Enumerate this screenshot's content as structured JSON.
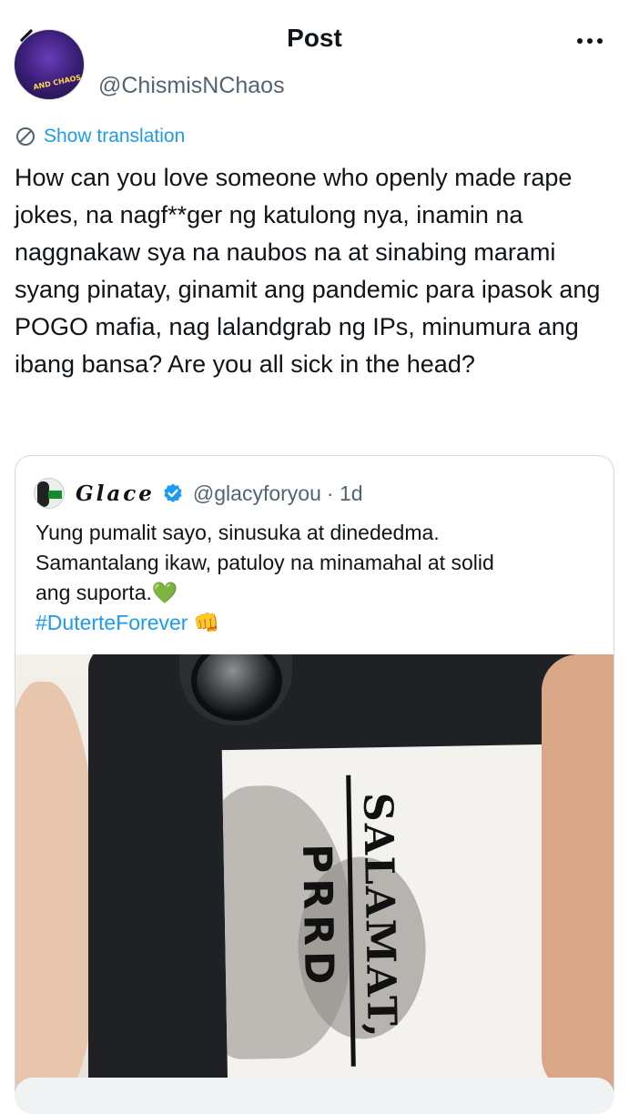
{
  "topbar": {
    "title": "Post"
  },
  "author": {
    "handle": "@ChismisNChaos",
    "avatar_text": "AND CHAOS"
  },
  "translation": {
    "label": "Show translation"
  },
  "post": {
    "text": "How can you love someone who openly made rape jokes, na nagf**ger ng katulong nya, inamin na naggnakaw sya na naubos na at sinabing marami syang pinatay, ginamit ang pandemic para ipasok ang POGO mafia, nag lalandgrab ng IPs, minumura ang ibang bansa? Are you all sick in the head?"
  },
  "quote": {
    "name": "Glace",
    "handle": "@glacyforyou",
    "time": "· 1d",
    "line1": "Yung pumalit sayo, sinusuka at dinededma.",
    "line2": "Samantalang ikaw, patuloy na minamahal at solid",
    "line3": "ang suporta.💚",
    "hashtag": "#DuterteForever",
    "hashtag_emoji": "👊",
    "photo": {
      "sticker_line1": "SALAMAT,",
      "sticker_line2": "PRRD"
    }
  }
}
